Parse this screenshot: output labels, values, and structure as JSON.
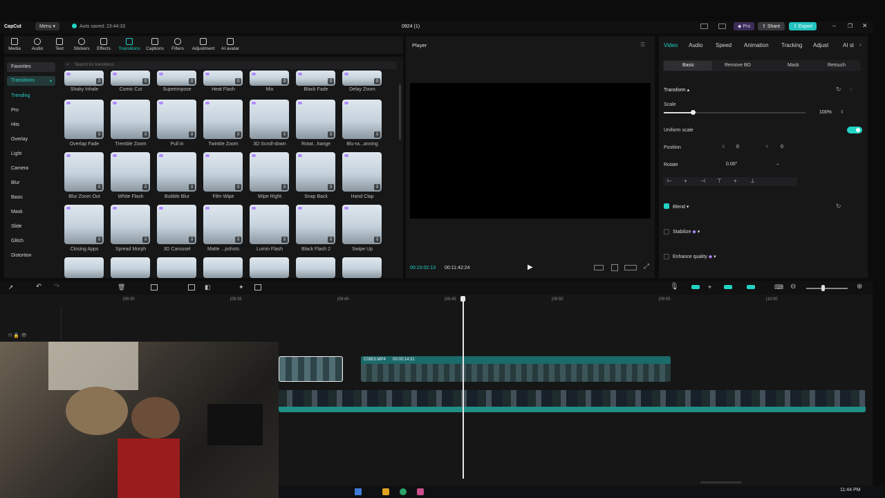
{
  "app": {
    "logo": "CapCut",
    "menu_label": "Menu",
    "autosave": "Auto saved: 23:44:33",
    "project_title": "0924 (1)",
    "pro_label": "Pro",
    "share_label": "Share",
    "export_label": "Export",
    "accent": "#22d3c5"
  },
  "toolbar": {
    "items": [
      {
        "label": "Media"
      },
      {
        "label": "Audio"
      },
      {
        "label": "Text"
      },
      {
        "label": "Stickers"
      },
      {
        "label": "Effects"
      },
      {
        "label": "Transitions",
        "active": true
      },
      {
        "label": "Captions"
      },
      {
        "label": "Filters"
      },
      {
        "label": "Adjustment"
      },
      {
        "label": "AI avatar"
      }
    ]
  },
  "left_nav": {
    "favorites": "Favorites",
    "transitions": "Transitions",
    "items": [
      "Trending",
      "Pro",
      "Hits",
      "Overlay",
      "Light",
      "Camera",
      "Blur",
      "Basic",
      "Mask",
      "Slide",
      "Glitch",
      "Distortion"
    ]
  },
  "search": {
    "placeholder": "Search for transitions"
  },
  "grid": {
    "rows": [
      [
        "Shaky Inhale",
        "Comic Cut",
        "Superimpose",
        "Heat Flash",
        "Mix",
        "Black Fade",
        "Delay Zoom"
      ],
      [
        "Overlap Fade",
        "Tremble Zoom",
        "Pull in",
        "Twinkle Zoom",
        "3D Scroll-down",
        "Rotat...hange",
        "Blu-ra...anning"
      ],
      [
        "Blur Zoom Out",
        "White Flash",
        "Bubble Blur",
        "Film Wipe",
        "Wipe Right",
        "Snap Back",
        "Hand Clap"
      ],
      [
        "Closing Apps",
        "Spread Morph",
        "3D Carousel",
        "Matte ...pshots",
        "Lumin Flash",
        "Black Flash 2",
        "Swipe Up"
      ]
    ]
  },
  "player": {
    "title": "Player",
    "current_time": "00:10:02:13",
    "total_time": "00:11:42:24"
  },
  "props": {
    "tabs": [
      "Video",
      "Audio",
      "Speed",
      "Animation",
      "Tracking",
      "Adjust",
      "AI st"
    ],
    "subtabs": [
      "Basic",
      "Remove BG",
      "Mask",
      "Retouch"
    ],
    "transform": "Transform",
    "scale_label": "Scale",
    "scale_value": "100%",
    "uniform_scale": "Uniform scale",
    "position_label": "Position",
    "x_label": "X",
    "x_value": "0",
    "y_label": "Y",
    "y_value": "0",
    "rotate_label": "Rotate",
    "rotate_value": "0.00°",
    "rotate_dash": "–",
    "blend": "Blend",
    "stabilize": "Stabilize",
    "enhance": "Enhance quality"
  },
  "timeline": {
    "ruler": [
      "|09:30",
      "|09:35",
      "|09:40",
      "|09:45",
      "|09:50",
      "|09:55",
      "|10:00"
    ],
    "clip_name": "C0853.MP4",
    "clip_duration": "00:00:14:31"
  },
  "taskbar": {
    "clock": "11:44 PM"
  }
}
